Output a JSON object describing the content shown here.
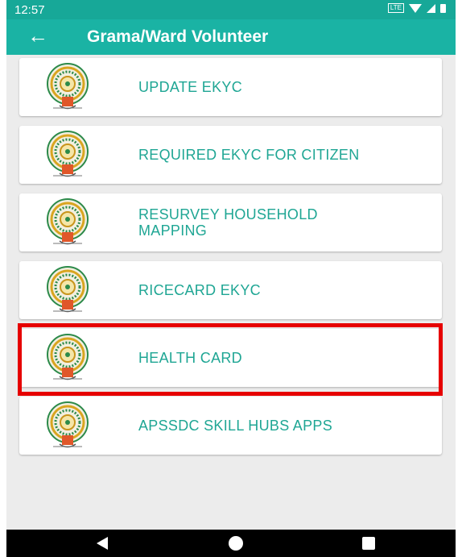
{
  "status_bar": {
    "time": "12:57",
    "network_label": "LTE"
  },
  "app_bar": {
    "title": "Grama/Ward Volunteer",
    "back_icon": "arrow-left-icon"
  },
  "menu_items": [
    {
      "label": "UPDATE EKYC",
      "icon": "ap-emblem-icon"
    },
    {
      "label": "REQUIRED EKYC FOR CITIZEN",
      "icon": "ap-emblem-icon"
    },
    {
      "label": "RESURVEY HOUSEHOLD MAPPING",
      "icon": "ap-emblem-icon"
    },
    {
      "label": "RICECARD EKYC",
      "icon": "ap-emblem-icon"
    },
    {
      "label": "HEALTH CARD",
      "icon": "ap-emblem-icon",
      "highlighted": true
    },
    {
      "label": "APSSDC SKILL HUBS APPS",
      "icon": "ap-emblem-icon"
    }
  ],
  "colors": {
    "primary": "#1ab3a4",
    "status_bar": "#17a898",
    "label_text": "#1fa694",
    "highlight_border": "#e60000",
    "background": "#ececec"
  },
  "nav_bar": {
    "icons": [
      "nav-back-icon",
      "nav-home-icon",
      "nav-recents-icon"
    ]
  }
}
